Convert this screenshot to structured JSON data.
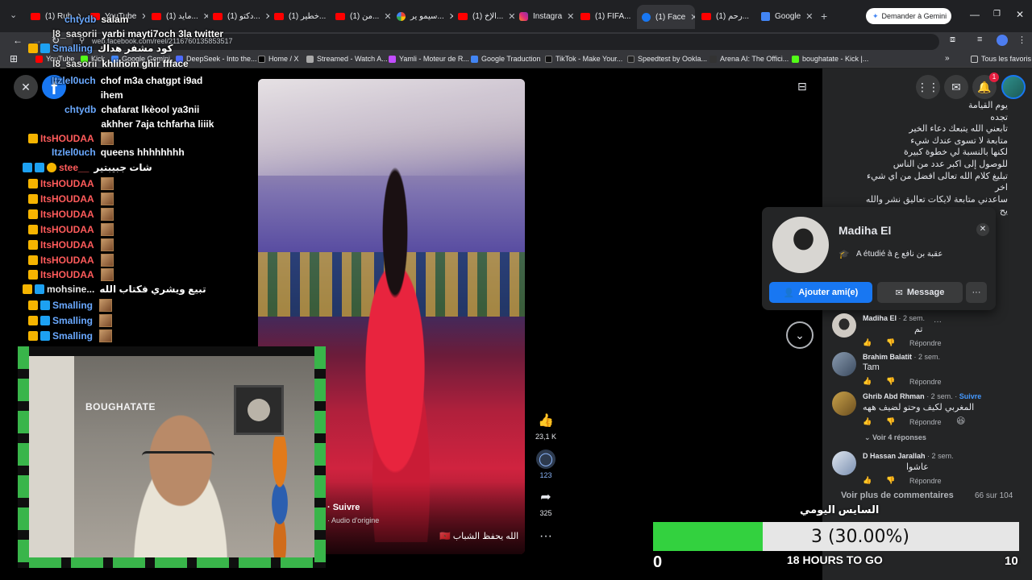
{
  "browser": {
    "tabs": [
      {
        "label": "(1) Rub",
        "icon": "youtube-icon"
      },
      {
        "label": "YouTube",
        "icon": "youtube-icon"
      },
      {
        "label": "(1) مايد...",
        "icon": "youtube-icon"
      },
      {
        "label": "(1) دكتو...",
        "icon": "youtube-icon"
      },
      {
        "label": "(1) خطير...",
        "icon": "youtube-icon"
      },
      {
        "label": "(1) من...",
        "icon": "youtube-icon"
      },
      {
        "label": "سيمو ير...",
        "icon": "google-icon"
      },
      {
        "label": "(1) الإخ...",
        "icon": "youtube-icon"
      },
      {
        "label": "Instagra",
        "icon": "instagram-icon"
      },
      {
        "label": "(1) FIFA...",
        "icon": "youtube-icon"
      },
      {
        "label": "(1) Face",
        "icon": "facebook-icon",
        "active": true
      },
      {
        "label": "(1) رحم...",
        "icon": "youtube-icon"
      },
      {
        "label": "Google",
        "icon": "google-icon"
      }
    ],
    "gemini_button": "Demander à Gemini",
    "url": "web.facebook.com/reel/2116760135853517",
    "bookmarks": [
      "YouTube",
      "Kick",
      "Google Gemini",
      "DeepSeek - Into the...",
      "Home / X",
      "Streamed - Watch A...",
      "Yamli - Moteur de R...",
      "Google Traduction",
      "TikTok - Make Your...",
      "Speedtest by Ookla...",
      "Arena AI: The Offici...",
      "boughatate - Kick |..."
    ],
    "all_bookmarks": "Tous les favoris"
  },
  "chat": [
    {
      "user": "chtydb",
      "msg": "salam",
      "color": "#6aa9ff"
    },
    {
      "user": "l8_sasorii",
      "msg": "yarbi mayti7och 3la twitter",
      "color": "#e6e6e6"
    },
    {
      "user": "Smalling",
      "msg": "كود مشفر هداك",
      "color": "#6aa9ff"
    },
    {
      "user": "l8_sasorii",
      "msg": "khlihom ghir ffface",
      "color": "#e6e6e6"
    },
    {
      "user": "Itzlel0uch",
      "msg": "chof m3a chatgpt i9ad ihem",
      "color": "#6aa9ff"
    },
    {
      "user": "chtydb",
      "msg": "chafarat lkèool ya3nii akhher 7aja tchfarha liiik",
      "color": "#6aa9ff"
    },
    {
      "user": "ItsHOUDAA",
      "msg": "",
      "color": "#ff5b5b"
    },
    {
      "user": "Itzlel0uch",
      "msg": "queens hhhhhhhh",
      "color": "#6aa9ff"
    },
    {
      "user": "stee__",
      "msg": "شات جبيبتير",
      "color": "#ff5b5b"
    },
    {
      "user": "ItsHOUDAA",
      "msg": "",
      "color": "#ff5b5b"
    },
    {
      "user": "mohsine...",
      "msg": "تبيع ويشري فكتاب الله",
      "color": "#e6e6e6"
    },
    {
      "user": "Smalling",
      "msg": "",
      "color": "#6aa9ff"
    }
  ],
  "webcam": {
    "sign": "BOUGHATATE"
  },
  "reel": {
    "likes": "23,1 K",
    "comments": "123",
    "shares": "325",
    "follow": "· Suivre",
    "audio": "· Audio d'origine",
    "caption": "الله يحفظ الشباب 🇲🇦"
  },
  "post_text": [
    "يوم القيامة",
    "تجده",
    "تابعني الله يتبعك دعاء الخير",
    "متابعة لا تسوى عندك شيء",
    "لكنها بالنسبة لي خطوة كبيرة",
    "للوصول إلى اكبر عدد من الناس",
    "تبليغ كلام الله تعالى افضل من اي شيء",
    "اخر",
    "ساعدني متابعة لايكات تعاليق نشر والله",
    "يح"
  ],
  "profile_card": {
    "name": "Madiha El",
    "studied": "A étudié à عقبة بن نافع ع",
    "add_friend": "Ajouter ami(e)",
    "message": "Message",
    "more": "···"
  },
  "comments": [
    {
      "name": "Madiha El",
      "time": "· 2 sem.",
      "text": "تم",
      "reply": "Répondre"
    },
    {
      "name": "Brahim Balatit",
      "time": "· 2 sem.",
      "text": "Tam",
      "reply": "Répondre"
    },
    {
      "name": "Ghrib Abd Rhman",
      "time": "· 2 sem. ·",
      "follow": "Suivre",
      "text": "المغربي لكيف وحتو لضيف ههه",
      "reply": "Répondre"
    },
    {
      "name": "D Hassan Jarallah",
      "time": "· 2 sem.",
      "text": "عاشوا",
      "reply": "Répondre"
    }
  ],
  "see_replies": "Voir 4 réponses",
  "more_comments": "Voir plus de commentaires",
  "comments_count": "66 sur 104",
  "overlay_title": "السايس اليومي",
  "goal": {
    "value_text": "3 (30.00%)",
    "progress": 0.3,
    "min": "0",
    "max": "10",
    "time_left": "18 HOURS TO GO",
    "fill_color": "#33d13f"
  },
  "notification_count": "1"
}
